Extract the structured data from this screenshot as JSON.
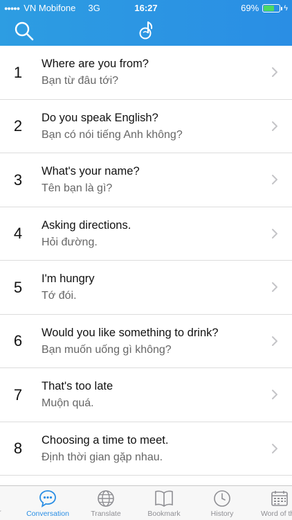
{
  "status": {
    "carrier": "VN Mobifone",
    "network": "3G",
    "time": "16:27",
    "battery": "69%",
    "battery_level": 0.69
  },
  "header": {
    "search_icon": "search-icon",
    "logo_icon": "app-logo-icon"
  },
  "phrases": [
    {
      "num": "1",
      "en": "Where are you from?",
      "vi": "Bạn từ đâu tới?"
    },
    {
      "num": "2",
      "en": "Do you speak English?",
      "vi": "Bạn có nói tiếng Anh không?"
    },
    {
      "num": "3",
      "en": "What's your name?",
      "vi": "Tên bạn là gì?"
    },
    {
      "num": "4",
      "en": "Asking directions.",
      "vi": "Hỏi đường."
    },
    {
      "num": "5",
      "en": "I'm hungry",
      "vi": "Tớ đói."
    },
    {
      "num": "6",
      "en": "Would you like something to drink?",
      "vi": "Bạn muốn uống gì không?"
    },
    {
      "num": "7",
      "en": "That's too late",
      "vi": "Muộn quá."
    },
    {
      "num": "8",
      "en": "Choosing a time to meet.",
      "vi": "Định thời gian gặp nhau."
    }
  ],
  "tabs": {
    "partial_left": "ar",
    "conversation": "Conversation",
    "translate": "Translate",
    "bookmark": "Bookmark",
    "history": "History",
    "word_of_day": "Word of the"
  },
  "colors": {
    "accent": "#2a8ee4",
    "header_start": "#2d9de2",
    "battery_fill": "#4cd964"
  }
}
